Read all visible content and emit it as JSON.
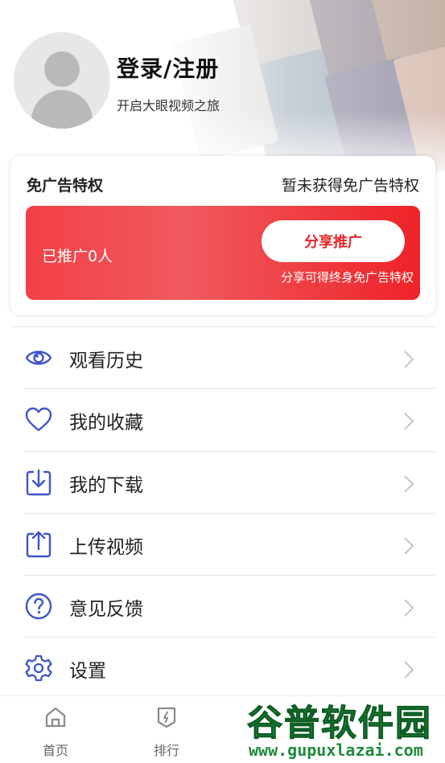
{
  "profile": {
    "login_title": "登录/注册",
    "login_subtitle": "开启大眼视频之旅"
  },
  "ad_free": {
    "title": "免广告特权",
    "status": "暂未获得免广告特权",
    "promoted_count": "已推广0人",
    "share_button": "分享推广",
    "share_hint": "分享可得终身免广告特权"
  },
  "menu": {
    "items": [
      {
        "label": "观看历史",
        "icon": "eye-icon"
      },
      {
        "label": "我的收藏",
        "icon": "heart-icon"
      },
      {
        "label": "我的下载",
        "icon": "download-icon"
      },
      {
        "label": "上传视频",
        "icon": "upload-icon"
      },
      {
        "label": "意见反馈",
        "icon": "question-icon"
      },
      {
        "label": "设置",
        "icon": "gear-icon"
      }
    ]
  },
  "tabbar": {
    "tabs": [
      {
        "label": "首页",
        "icon": "home-icon"
      },
      {
        "label": "排行",
        "icon": "ranking-icon"
      }
    ]
  },
  "watermark": {
    "title": "谷普软件园",
    "url": "www.gupuxlazai.com"
  },
  "colors": {
    "accent_red": "#ee2328",
    "icon_blue": "#3f55c9",
    "watermark_green": "#1f8a3c"
  }
}
